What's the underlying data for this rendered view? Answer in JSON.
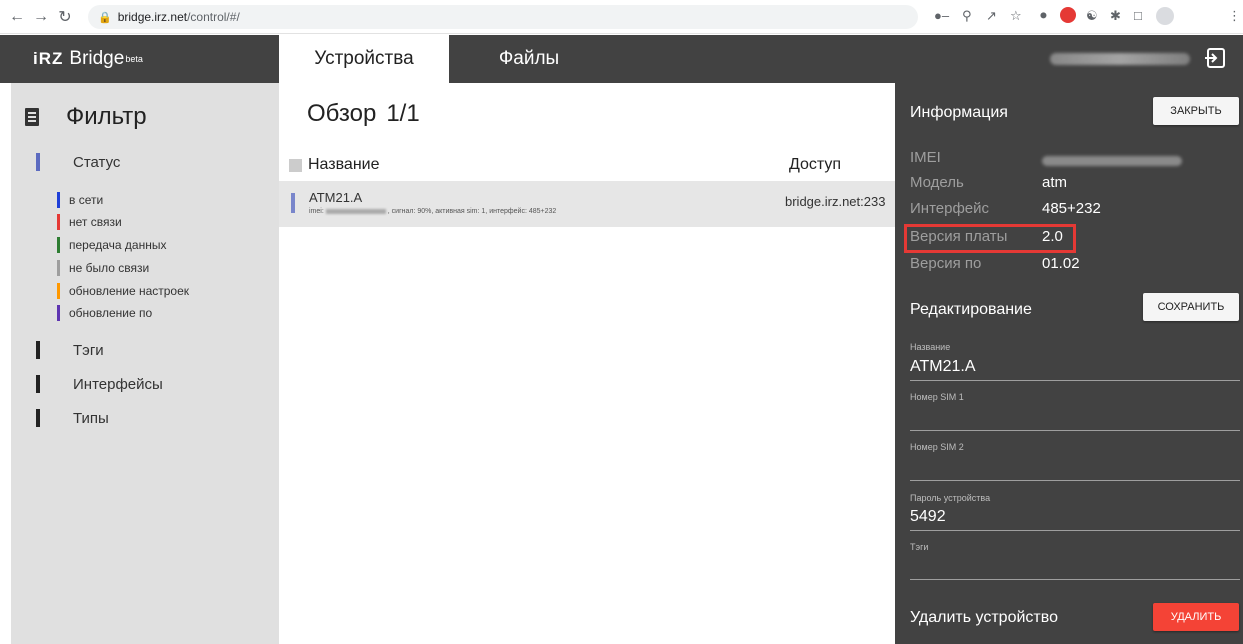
{
  "browser": {
    "url_host": "bridge.irz.net",
    "url_path": "/control/#/"
  },
  "header": {
    "logo": "iRZ",
    "app_name": "Bridge",
    "badge": "beta",
    "tabs": [
      {
        "label": "Устройства",
        "active": true
      },
      {
        "label": "Файлы",
        "active": false
      }
    ]
  },
  "sidebar": {
    "title": "Фильтр",
    "status": {
      "label": "Статус",
      "items": [
        {
          "label": "в сети",
          "color": "#1e3fd8"
        },
        {
          "label": "нет связи",
          "color": "#e53935"
        },
        {
          "label": "передача данных",
          "color": "#2e7d32"
        },
        {
          "label": "не было связи",
          "color": "#9e9e9e"
        },
        {
          "label": "обновление настроек",
          "color": "#ff9800"
        },
        {
          "label": "обновление по",
          "color": "#5e35b1"
        }
      ]
    },
    "sections": [
      "Тэги",
      "Интерфейсы",
      "Типы"
    ]
  },
  "main": {
    "title": "Обзор",
    "count": "1/1",
    "columns": [
      "Название",
      "Доступ"
    ],
    "rows": [
      {
        "name": "ATM21.A",
        "sub_prefix": "imei:",
        "sub_rest": ", сигнал: 90%, активная sim: 1, интерфейс: 485+232",
        "access": "bridge.irz.net:233"
      }
    ]
  },
  "panel": {
    "info_title": "Информация",
    "close_label": "ЗАКРЫТЬ",
    "info": {
      "imei_label": "IMEI",
      "model_label": "Модель",
      "model_value": "atm",
      "iface_label": "Интерфейс",
      "iface_value": "485+232",
      "board_label": "Версия платы",
      "board_value": "2.0",
      "sw_label": "Версия по",
      "sw_value": "01.02"
    },
    "edit_title": "Редактирование",
    "save_label": "СОХРАНИТЬ",
    "fields": {
      "name_label": "Название",
      "name_value": "ATM21.A",
      "sim1_label": "Номер SIM 1",
      "sim1_value": "",
      "sim2_label": "Номер SIM 2",
      "sim2_value": "",
      "password_label": "Пароль устройства",
      "password_value": "5492",
      "tags_label": "Тэги",
      "tags_value": ""
    },
    "delete_title": "Удалить устройство",
    "delete_label": "УДАЛИТЬ"
  }
}
